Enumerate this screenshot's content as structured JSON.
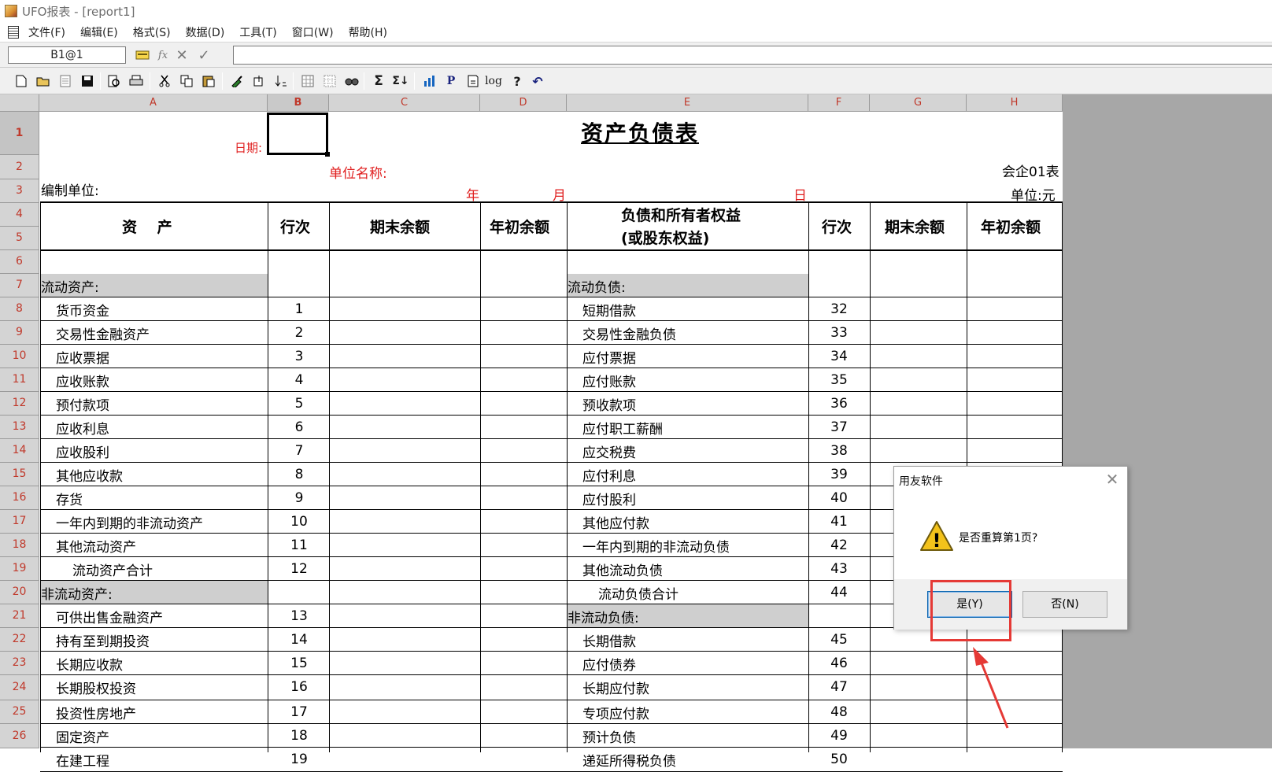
{
  "window": {
    "title": "UFO报表 - [report1]"
  },
  "menu": [
    "文件(F)",
    "编辑(E)",
    "格式(S)",
    "数据(D)",
    "工具(T)",
    "窗口(W)",
    "帮助(H)"
  ],
  "formula_bar": {
    "cell_ref": "B1@1",
    "fx_label": "fx",
    "cancel_icon": "✕",
    "confirm_icon": "✓",
    "value": ""
  },
  "toolbar": [
    "new-icon",
    "open-icon",
    "page-icon",
    "save-icon",
    "preview-icon",
    "print-icon",
    "cut-icon",
    "copy-icon",
    "paste-icon",
    "format-brush-icon",
    "fill-icon",
    "sort-icon",
    "grid-icon",
    "hide-grid-icon",
    "find-icon",
    "sum-icon",
    "sum-sheet-icon",
    "chart-icon",
    "p-icon",
    "page-setup-icon",
    "log-icon",
    "help-icon",
    "undo-icon"
  ],
  "toolbar_text": {
    "p": "P",
    "log": "log",
    "sigma": "Σ",
    "sigma2": "Σ↓",
    "help": "?",
    "undo": "↶"
  },
  "columns": [
    "A",
    "B",
    "C",
    "D",
    "E",
    "F",
    "G",
    "H"
  ],
  "rows": [
    "1",
    "2",
    "3",
    "4",
    "5",
    "6",
    "7",
    "8",
    "9",
    "10",
    "11",
    "12",
    "13",
    "14",
    "15",
    "16",
    "17",
    "18",
    "19",
    "20",
    "21",
    "22",
    "23",
    "24",
    "25",
    "26"
  ],
  "report": {
    "title": "资产负债表",
    "date_label": "日期:",
    "unit_name_label": "单位名称:",
    "form_no": "会企01表",
    "compiler_label": "编制单位:",
    "year": "年",
    "month": "月",
    "day": "日",
    "currency_unit": "单位:元",
    "headers": {
      "assets": "资　 产",
      "line_no": "行次",
      "end_balance": "期末余额",
      "begin_balance": "年初余额",
      "liabilities_line1": "负债和所有者权益",
      "liabilities_line2": "(或股东权益)"
    },
    "left_rows": [
      {
        "label": "流动资产:",
        "no": ""
      },
      {
        "label": "货币资金",
        "no": "1"
      },
      {
        "label": "交易性金融资产",
        "no": "2"
      },
      {
        "label": "应收票据",
        "no": "3"
      },
      {
        "label": "应收账款",
        "no": "4"
      },
      {
        "label": "预付款项",
        "no": "5"
      },
      {
        "label": "应收利息",
        "no": "6"
      },
      {
        "label": "应收股利",
        "no": "7"
      },
      {
        "label": "其他应收款",
        "no": "8"
      },
      {
        "label": "存货",
        "no": "9"
      },
      {
        "label": "一年内到期的非流动资产",
        "no": "10"
      },
      {
        "label": "其他流动资产",
        "no": "11"
      },
      {
        "label": "流动资产合计",
        "no": "12"
      },
      {
        "label": "非流动资产:",
        "no": ""
      },
      {
        "label": "可供出售金融资产",
        "no": "13"
      },
      {
        "label": "持有至到期投资",
        "no": "14"
      },
      {
        "label": "长期应收款",
        "no": "15"
      },
      {
        "label": "长期股权投资",
        "no": "16"
      },
      {
        "label": "投资性房地产",
        "no": "17"
      },
      {
        "label": "固定资产",
        "no": "18"
      },
      {
        "label": "在建工程",
        "no": "19"
      }
    ],
    "right_rows": [
      {
        "label": "流动负债:",
        "no": ""
      },
      {
        "label": "短期借款",
        "no": "32"
      },
      {
        "label": "交易性金融负债",
        "no": "33"
      },
      {
        "label": "应付票据",
        "no": "34"
      },
      {
        "label": "应付账款",
        "no": "35"
      },
      {
        "label": "预收款项",
        "no": "36"
      },
      {
        "label": "应付职工薪酬",
        "no": "37"
      },
      {
        "label": "应交税费",
        "no": "38"
      },
      {
        "label": "应付利息",
        "no": "39"
      },
      {
        "label": "应付股利",
        "no": "40"
      },
      {
        "label": "其他应付款",
        "no": "41"
      },
      {
        "label": "一年内到期的非流动负债",
        "no": "42"
      },
      {
        "label": "其他流动负债",
        "no": "43"
      },
      {
        "label": "流动负债合计",
        "no": "44"
      },
      {
        "label": "非流动负债:",
        "no": ""
      },
      {
        "label": "长期借款",
        "no": "45"
      },
      {
        "label": "应付债券",
        "no": "46"
      },
      {
        "label": "长期应付款",
        "no": "47"
      },
      {
        "label": "专项应付款",
        "no": "48"
      },
      {
        "label": "预计负债",
        "no": "49"
      },
      {
        "label": "递延所得税负债",
        "no": "50"
      }
    ]
  },
  "dialog": {
    "title": "用友软件",
    "message": "是否重算第1页?",
    "yes_label": "是(Y)",
    "no_label": "否(N)",
    "close_icon": "✕",
    "warning_icon": "!"
  },
  "colors": {
    "accent_red": "#e53935",
    "row_header_text": "#c0392b",
    "section_fill": "#cfcfcf"
  }
}
